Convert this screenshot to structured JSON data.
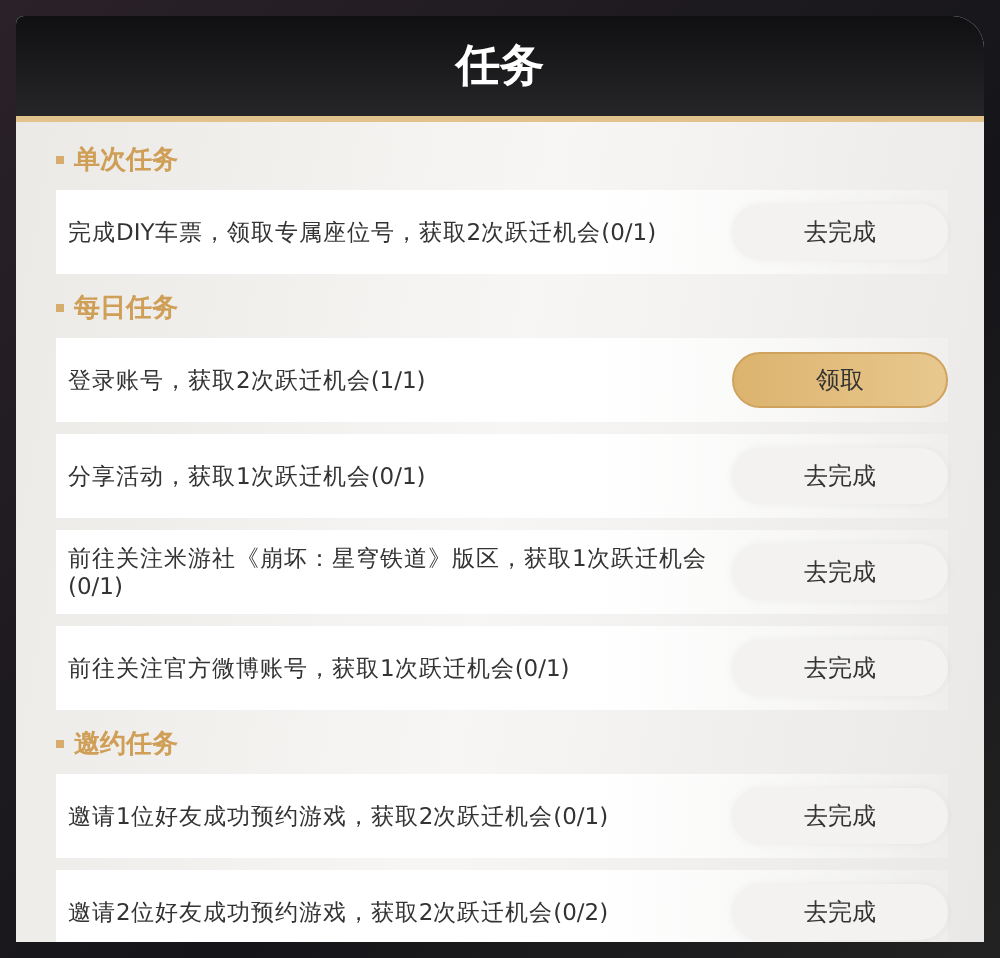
{
  "title": "任务",
  "sections": [
    {
      "title": "单次任务",
      "tasks": [
        {
          "text": "完成DIY车票，领取专属座位号，获取2次跃迁机会(0/1)",
          "button": {
            "label": "去完成",
            "kind": "go"
          }
        }
      ]
    },
    {
      "title": "每日任务",
      "tasks": [
        {
          "text": "登录账号，获取2次跃迁机会(1/1)",
          "button": {
            "label": "领取",
            "kind": "claim"
          }
        },
        {
          "text": "分享活动，获取1次跃迁机会(0/1)",
          "button": {
            "label": "去完成",
            "kind": "go"
          }
        },
        {
          "text": "前往关注米游社《崩坏：星穹铁道》版区，获取1次跃迁机会(0/1)",
          "button": {
            "label": "去完成",
            "kind": "go"
          }
        },
        {
          "text": "前往关注官方微博账号，获取1次跃迁机会(0/1)",
          "button": {
            "label": "去完成",
            "kind": "go"
          }
        }
      ]
    },
    {
      "title": "邀约任务",
      "tasks": [
        {
          "text": "邀请1位好友成功预约游戏，获取2次跃迁机会(0/1)",
          "button": {
            "label": "去完成",
            "kind": "go"
          }
        },
        {
          "text": "邀请2位好友成功预约游戏，获取2次跃迁机会(0/2)",
          "button": {
            "label": "去完成",
            "kind": "go"
          }
        }
      ]
    }
  ]
}
